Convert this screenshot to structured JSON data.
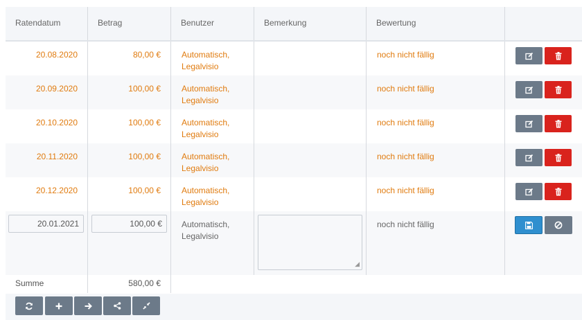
{
  "columns": {
    "date": "Ratendatum",
    "amount": "Betrag",
    "user": "Benutzer",
    "note": "Bemerkung",
    "evaluation": "Bewertung"
  },
  "rows": [
    {
      "date": "20.08.2020",
      "amount": "80,00 €",
      "user": "Automatisch, Legalvisio",
      "evaluation": "noch nicht fällig"
    },
    {
      "date": "20.09.2020",
      "amount": "100,00 €",
      "user": "Automatisch, Legalvisio",
      "evaluation": "noch nicht fällig"
    },
    {
      "date": "20.10.2020",
      "amount": "100,00 €",
      "user": "Automatisch, Legalvisio",
      "evaluation": "noch nicht fällig"
    },
    {
      "date": "20.11.2020",
      "amount": "100,00 €",
      "user": "Automatisch, Legalvisio",
      "evaluation": "noch nicht fällig"
    },
    {
      "date": "20.12.2020",
      "amount": "100,00 €",
      "user": "Automatisch, Legalvisio",
      "evaluation": "noch nicht fällig"
    }
  ],
  "edit_row": {
    "date": "20.01.2021",
    "amount": "100,00 €",
    "user": "Automatisch, Legalvisio",
    "note": "",
    "evaluation": "noch nicht fällig"
  },
  "summary": {
    "label": "Summe",
    "value": "580,00 €"
  },
  "icons": {
    "row_actions": [
      "edit-icon",
      "trash-icon"
    ],
    "edit_actions": [
      "save-icon",
      "cancel-icon"
    ],
    "toolbar": [
      "refresh-icon",
      "plus-icon",
      "arrow-right-icon",
      "share-icon",
      "compress-icon"
    ]
  },
  "colors": {
    "accent_orange": "#e07b0f",
    "button_gray": "#6c7a89",
    "button_red": "#d9231d",
    "button_blue": "#2f8fcf"
  }
}
